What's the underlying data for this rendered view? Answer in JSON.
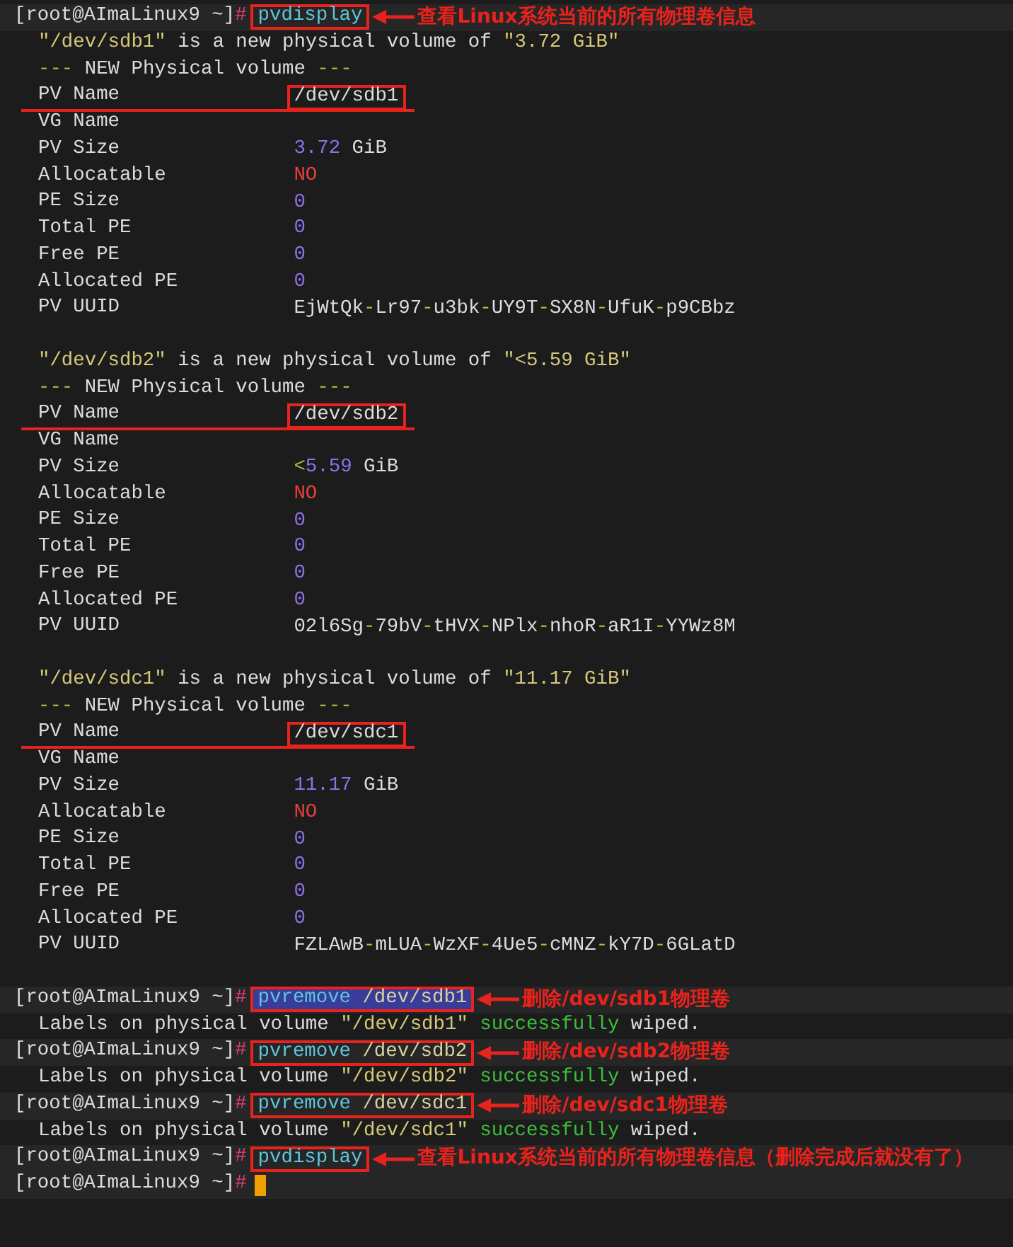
{
  "terminal": {
    "lines": [
      {
        "kind": "prompt",
        "prompt": "[root@AImaLinux9 ~]",
        "symbol": "#",
        "command": "pvdisplay",
        "selected": false,
        "boxed": true,
        "annotation": "查看Linux系统当前的所有物理卷信息"
      },
      {
        "kind": "output",
        "segments": [
          {
            "text": "\"/dev/sdb1\"",
            "color": "#d6c97a"
          },
          {
            "text": " is a new physical volume of "
          },
          {
            "text": "\"3.72 GiB\"",
            "color": "#d6c97a"
          }
        ]
      },
      {
        "kind": "output",
        "segments": [
          {
            "text": "---",
            "color": "#a6c23a"
          },
          {
            "text": " NEW Physical volume "
          },
          {
            "text": "---",
            "color": "#a6c23a"
          }
        ]
      },
      {
        "kind": "field",
        "label": "PV Name",
        "value": [
          {
            "text": "/dev/sdb1"
          }
        ],
        "marked": true
      },
      {
        "kind": "field",
        "label": "VG Name"
      },
      {
        "kind": "field",
        "label": "PV Size",
        "value": [
          {
            "text": "3.72",
            "color": "#8f72e8"
          },
          {
            "text": " GiB"
          }
        ]
      },
      {
        "kind": "field",
        "label": "Allocatable",
        "value": [
          {
            "text": "NO",
            "color": "#e8403c"
          }
        ]
      },
      {
        "kind": "field",
        "label": "PE Size",
        "value": [
          {
            "text": "0",
            "color": "#8f72e8"
          }
        ]
      },
      {
        "kind": "field",
        "label": "Total PE",
        "value": [
          {
            "text": "0",
            "color": "#8f72e8"
          }
        ]
      },
      {
        "kind": "field",
        "label": "Free PE",
        "value": [
          {
            "text": "0",
            "color": "#8f72e8"
          }
        ]
      },
      {
        "kind": "field",
        "label": "Allocated PE",
        "value": [
          {
            "text": "0",
            "color": "#8f72e8"
          }
        ]
      },
      {
        "kind": "field",
        "label": "PV UUID",
        "value": [
          {
            "text": "EjWtQk"
          },
          {
            "text": "-",
            "color": "#a6c23a"
          },
          {
            "text": "Lr97"
          },
          {
            "text": "-",
            "color": "#a6c23a"
          },
          {
            "text": "u3bk"
          },
          {
            "text": "-",
            "color": "#a6c23a"
          },
          {
            "text": "UY9T"
          },
          {
            "text": "-",
            "color": "#a6c23a"
          },
          {
            "text": "SX8N"
          },
          {
            "text": "-",
            "color": "#a6c23a"
          },
          {
            "text": "UfuK"
          },
          {
            "text": "-",
            "color": "#a6c23a"
          },
          {
            "text": "p9CBbz"
          }
        ]
      },
      {
        "kind": "blank"
      },
      {
        "kind": "output",
        "segments": [
          {
            "text": "\"/dev/sdb2\"",
            "color": "#d6c97a"
          },
          {
            "text": " is a new physical volume of "
          },
          {
            "text": "\"<5.59 GiB\"",
            "color": "#d6c97a"
          }
        ]
      },
      {
        "kind": "output",
        "segments": [
          {
            "text": "---",
            "color": "#a6c23a"
          },
          {
            "text": " NEW Physical volume "
          },
          {
            "text": "---",
            "color": "#a6c23a"
          }
        ]
      },
      {
        "kind": "field",
        "label": "PV Name",
        "value": [
          {
            "text": "/dev/sdb2"
          }
        ],
        "marked": true
      },
      {
        "kind": "field",
        "label": "VG Name"
      },
      {
        "kind": "field",
        "label": "PV Size",
        "value": [
          {
            "text": "<",
            "color": "#a6c23a"
          },
          {
            "text": "5.59",
            "color": "#8f72e8"
          },
          {
            "text": " GiB"
          }
        ]
      },
      {
        "kind": "field",
        "label": "Allocatable",
        "value": [
          {
            "text": "NO",
            "color": "#e8403c"
          }
        ]
      },
      {
        "kind": "field",
        "label": "PE Size",
        "value": [
          {
            "text": "0",
            "color": "#8f72e8"
          }
        ]
      },
      {
        "kind": "field",
        "label": "Total PE",
        "value": [
          {
            "text": "0",
            "color": "#8f72e8"
          }
        ]
      },
      {
        "kind": "field",
        "label": "Free PE",
        "value": [
          {
            "text": "0",
            "color": "#8f72e8"
          }
        ]
      },
      {
        "kind": "field",
        "label": "Allocated PE",
        "value": [
          {
            "text": "0",
            "color": "#8f72e8"
          }
        ]
      },
      {
        "kind": "field",
        "label": "PV UUID",
        "value": [
          {
            "text": "02l6Sg"
          },
          {
            "text": "-",
            "color": "#a6c23a"
          },
          {
            "text": "79bV"
          },
          {
            "text": "-",
            "color": "#a6c23a"
          },
          {
            "text": "tHVX"
          },
          {
            "text": "-",
            "color": "#a6c23a"
          },
          {
            "text": "NPlx"
          },
          {
            "text": "-",
            "color": "#a6c23a"
          },
          {
            "text": "nhoR"
          },
          {
            "text": "-",
            "color": "#a6c23a"
          },
          {
            "text": "aR1I"
          },
          {
            "text": "-",
            "color": "#a6c23a"
          },
          {
            "text": "YYWz8M"
          }
        ]
      },
      {
        "kind": "blank"
      },
      {
        "kind": "output",
        "segments": [
          {
            "text": "\"/dev/sdc1\"",
            "color": "#d6c97a"
          },
          {
            "text": " is a new physical volume of "
          },
          {
            "text": "\"11.17 GiB\"",
            "color": "#d6c97a"
          }
        ]
      },
      {
        "kind": "output",
        "segments": [
          {
            "text": "---",
            "color": "#a6c23a"
          },
          {
            "text": " NEW Physical volume "
          },
          {
            "text": "---",
            "color": "#a6c23a"
          }
        ]
      },
      {
        "kind": "field",
        "label": "PV Name",
        "value": [
          {
            "text": "/dev/sdc1"
          }
        ],
        "marked": true
      },
      {
        "kind": "field",
        "label": "VG Name"
      },
      {
        "kind": "field",
        "label": "PV Size",
        "value": [
          {
            "text": "11.17",
            "color": "#8f72e8"
          },
          {
            "text": " GiB"
          }
        ]
      },
      {
        "kind": "field",
        "label": "Allocatable",
        "value": [
          {
            "text": "NO",
            "color": "#e8403c"
          }
        ]
      },
      {
        "kind": "field",
        "label": "PE Size",
        "value": [
          {
            "text": "0",
            "color": "#8f72e8"
          }
        ]
      },
      {
        "kind": "field",
        "label": "Total PE",
        "value": [
          {
            "text": "0",
            "color": "#8f72e8"
          }
        ]
      },
      {
        "kind": "field",
        "label": "Free PE",
        "value": [
          {
            "text": "0",
            "color": "#8f72e8"
          }
        ]
      },
      {
        "kind": "field",
        "label": "Allocated PE",
        "value": [
          {
            "text": "0",
            "color": "#8f72e8"
          }
        ]
      },
      {
        "kind": "field",
        "label": "PV UUID",
        "value": [
          {
            "text": "FZLAwB"
          },
          {
            "text": "-",
            "color": "#a6c23a"
          },
          {
            "text": "mLUA"
          },
          {
            "text": "-",
            "color": "#a6c23a"
          },
          {
            "text": "WzXF"
          },
          {
            "text": "-",
            "color": "#a6c23a"
          },
          {
            "text": "4Ue5"
          },
          {
            "text": "-",
            "color": "#a6c23a"
          },
          {
            "text": "cMNZ"
          },
          {
            "text": "-",
            "color": "#a6c23a"
          },
          {
            "text": "kY7D"
          },
          {
            "text": "-",
            "color": "#a6c23a"
          },
          {
            "text": "6GLatD"
          }
        ]
      },
      {
        "kind": "blank"
      },
      {
        "kind": "prompt",
        "prompt": "[root@AImaLinux9 ~]",
        "symbol": "#",
        "command": "pvremove",
        "argument": "/dev/sdb1",
        "selected": true,
        "boxed": true,
        "annotation": "删除/dev/sdb1物理卷"
      },
      {
        "kind": "output",
        "segments": [
          {
            "text": "Labels on physical volume "
          },
          {
            "text": "\"/dev/sdb1\"",
            "color": "#d6c97a"
          },
          {
            "text": " successfully",
            "color": "#3cbf3c"
          },
          {
            "text": " wiped."
          }
        ]
      },
      {
        "kind": "prompt",
        "prompt": "[root@AImaLinux9 ~]",
        "symbol": "#",
        "command": "pvremove",
        "argument": "/dev/sdb2",
        "selected": false,
        "boxed": true,
        "annotation": "删除/dev/sdb2物理卷"
      },
      {
        "kind": "output",
        "segments": [
          {
            "text": "Labels on physical volume "
          },
          {
            "text": "\"/dev/sdb2\"",
            "color": "#d6c97a"
          },
          {
            "text": " successfully",
            "color": "#3cbf3c"
          },
          {
            "text": " wiped."
          }
        ]
      },
      {
        "kind": "prompt",
        "prompt": "[root@AImaLinux9 ~]",
        "symbol": "#",
        "command": "pvremove",
        "argument": "/dev/sdc1",
        "selected": false,
        "boxed": true,
        "annotation": "删除/dev/sdc1物理卷"
      },
      {
        "kind": "output",
        "segments": [
          {
            "text": "Labels on physical volume "
          },
          {
            "text": "\"/dev/sdc1\"",
            "color": "#d6c97a"
          },
          {
            "text": " successfully",
            "color": "#3cbf3c"
          },
          {
            "text": " wiped."
          }
        ]
      },
      {
        "kind": "prompt",
        "prompt": "[root@AImaLinux9 ~]",
        "symbol": "#",
        "command": "pvdisplay",
        "selected": false,
        "boxed": true,
        "annotation": "查看Linux系统当前的所有物理卷信息（删除完成后就没有了）"
      },
      {
        "kind": "prompt",
        "prompt": "[root@AImaLinux9 ~]",
        "symbol": "#",
        "cursor": true
      }
    ]
  }
}
